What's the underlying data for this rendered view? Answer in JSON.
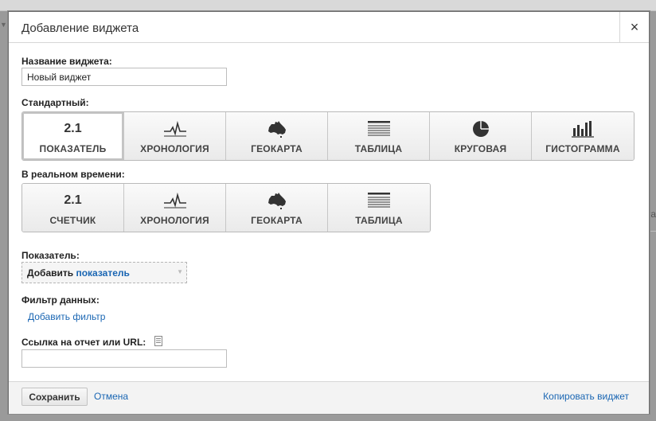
{
  "dialog": {
    "title": "Добавление виджета",
    "close": "×"
  },
  "name_field": {
    "label": "Название виджета:",
    "value": "Новый виджет"
  },
  "standard": {
    "label": "Стандартный:",
    "tiles": [
      {
        "icon": "metric-number",
        "number": "2.1",
        "label": "ПОКАЗАТЕЛЬ",
        "selected": true
      },
      {
        "icon": "timeline",
        "label": "ХРОНОЛОГИЯ"
      },
      {
        "icon": "australia-map",
        "label": "ГЕОКАРТА"
      },
      {
        "icon": "table-lines",
        "label": "ТАБЛИЦА"
      },
      {
        "icon": "pie-chart",
        "label": "КРУГОВАЯ"
      },
      {
        "icon": "bar-chart",
        "label": "ГИСТОГРАММА"
      }
    ]
  },
  "realtime": {
    "label": "В реальном времени:",
    "tiles": [
      {
        "icon": "metric-number",
        "number": "2.1",
        "label": "СЧЕТЧИК"
      },
      {
        "icon": "timeline",
        "label": "ХРОНОЛОГИЯ"
      },
      {
        "icon": "australia-map",
        "label": "ГЕОКАРТА"
      },
      {
        "icon": "table-lines",
        "label": "ТАБЛИЦА"
      }
    ]
  },
  "metric": {
    "label": "Показатель:",
    "add_prefix": "Добавить",
    "add_link": "показатель"
  },
  "filter": {
    "label": "Фильтр данных:",
    "add_link": "Добавить фильтр"
  },
  "link_field": {
    "label": "Ссылка на отчет или URL:",
    "value": ""
  },
  "footer": {
    "save": "Сохранить",
    "cancel": "Отмена",
    "copy": "Копировать виджет"
  },
  "colors": {
    "accent": "#1a66b3"
  }
}
